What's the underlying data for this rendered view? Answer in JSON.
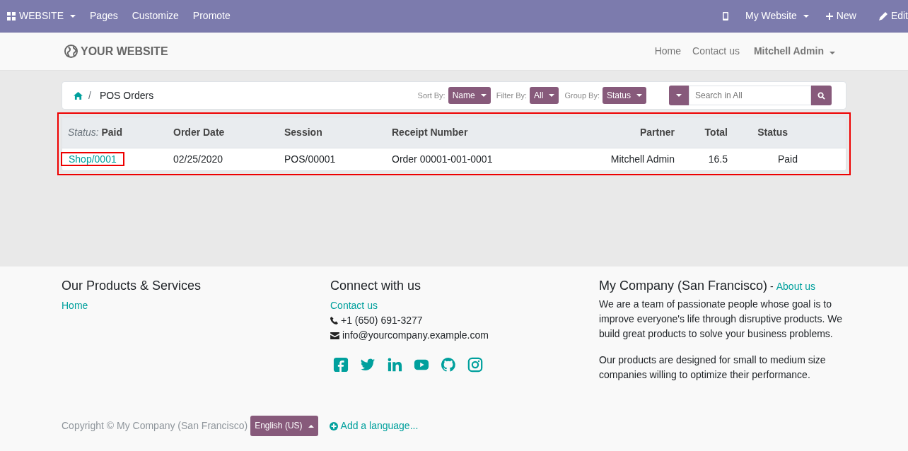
{
  "topbar": {
    "menus": [
      {
        "label": "WEBSITE",
        "kind": "apps"
      },
      {
        "label": "Pages",
        "kind": "plain"
      },
      {
        "label": "Customize",
        "kind": "plain"
      },
      {
        "label": "Promote",
        "kind": "plain"
      }
    ],
    "right": [
      {
        "kind": "mobile"
      },
      {
        "label": "My Website",
        "kind": "dropdown"
      },
      {
        "label": "New",
        "kind": "new"
      },
      {
        "label": "Edit",
        "kind": "edit"
      }
    ]
  },
  "header": {
    "logo": "YOUR WEBSITE",
    "nav": [
      "Home",
      "Contact us"
    ],
    "user": "Mitchell Admin"
  },
  "breadcrumb": {
    "separator": "/",
    "current": "POS Orders"
  },
  "controls": [
    {
      "label": "Sort By:",
      "value": "Name"
    },
    {
      "label": "Filter By:",
      "value": "All"
    },
    {
      "label": "Group By:",
      "value": "Status"
    }
  ],
  "search": {
    "placeholder": "Search in All"
  },
  "table": {
    "highlighted": true,
    "group_label": "Status:",
    "group_value": "Paid",
    "columns": [
      "Order Date",
      "Session",
      "Receipt Number",
      "Partner",
      "Total",
      "Status"
    ],
    "rows": [
      {
        "order": "Shop/0001",
        "highlighted": true,
        "cells": [
          "02/25/2020",
          "POS/00001",
          "Order 00001-001-0001",
          "Mitchell Admin",
          "16.5",
          "Paid"
        ]
      }
    ]
  },
  "footer": {
    "col1": {
      "title": "Our Products & Services",
      "links": [
        "Home"
      ]
    },
    "col2": {
      "title": "Connect with us",
      "link": "Contact us",
      "phone": "+1 (650) 691-3277",
      "email": "info@yourcompany.example.com",
      "social": [
        {
          "kind": "facebook"
        },
        {
          "kind": "twitter"
        },
        {
          "kind": "linkedin"
        },
        {
          "kind": "youtube"
        },
        {
          "kind": "github"
        },
        {
          "kind": "instagram"
        }
      ]
    },
    "col3": {
      "title": "My Company (San Francisco)",
      "sep": " - ",
      "link": "About us",
      "paragraphs": [
        "We are a team of passionate people whose goal is to improve everyone's life through disruptive products. We build great products to solve your business problems.",
        "Our products are designed for small to medium size companies willing to optimize their performance."
      ]
    },
    "copyright": "Copyright © My Company (San Francisco)",
    "language": "English (US)",
    "add_language": "Add a language..."
  }
}
